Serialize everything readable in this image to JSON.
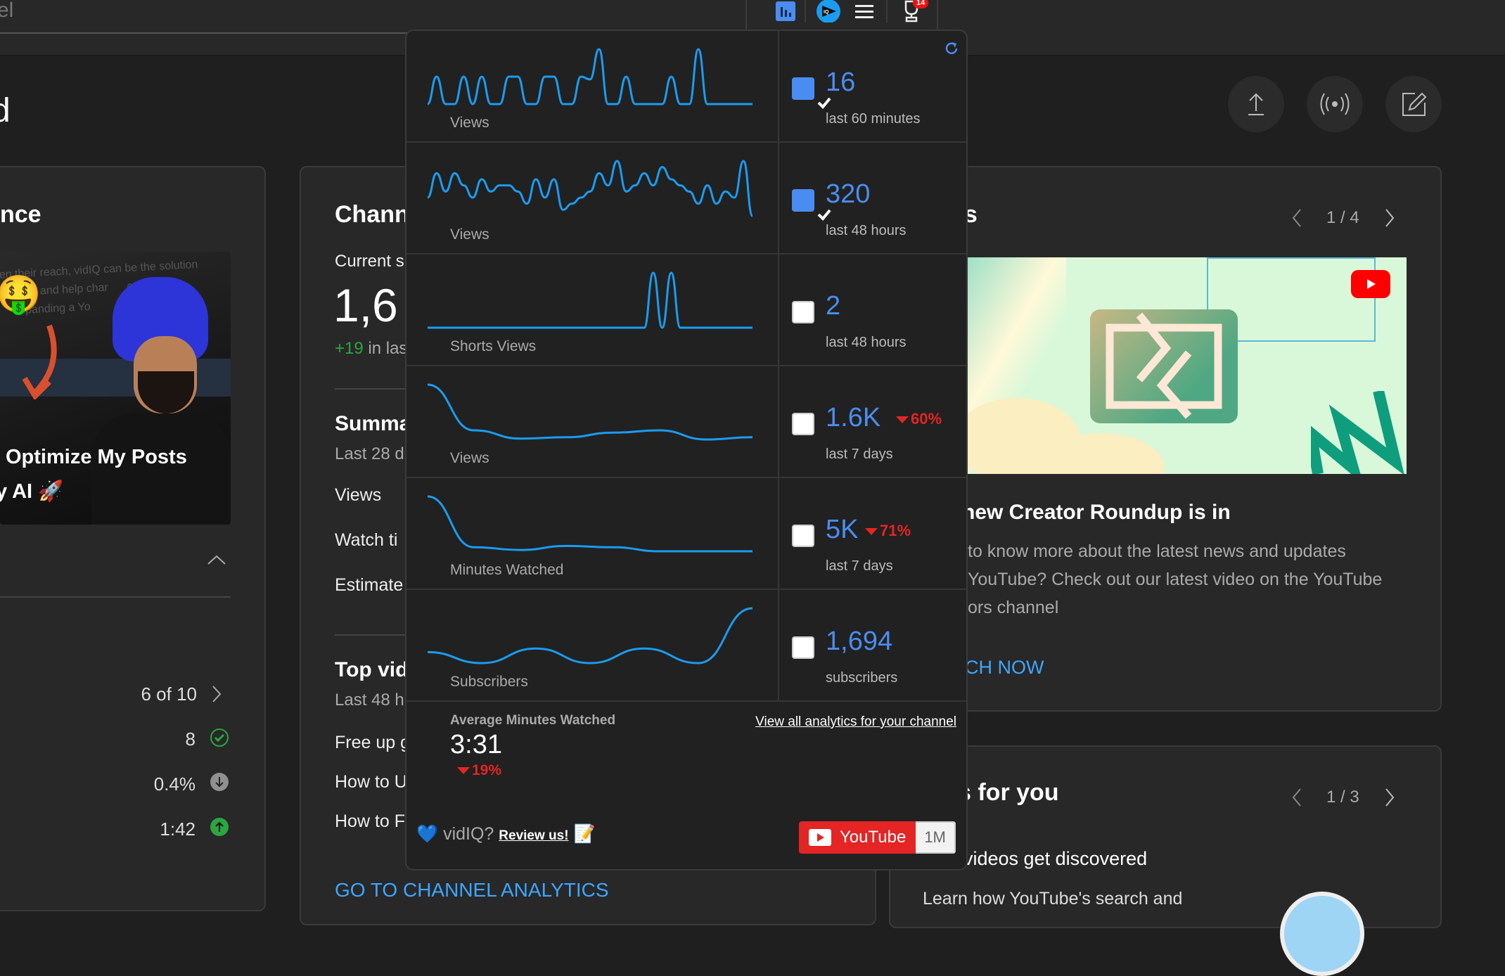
{
  "topbar": {
    "search_value": "el",
    "extension_badge": "14",
    "icons": [
      "analytics-icon",
      "vidiq-icon",
      "menu-icon",
      "achievements-icon"
    ]
  },
  "page": {
    "title": "d"
  },
  "header_actions": [
    "upload-icon",
    "live-icon",
    "create-post-icon"
  ],
  "perf_card": {
    "title": "nce",
    "thumbnail_caption_line1": "Optimize My Posts",
    "thumbnail_caption_line2": "y AI 🚀",
    "ranking": "6 of 10",
    "stats": [
      {
        "value": "8",
        "icon": "check-circle-icon"
      },
      {
        "value": "0.4%",
        "icon": "arrow-down-circle-icon"
      },
      {
        "value": "1:42",
        "icon": "arrow-up-circle-icon"
      }
    ]
  },
  "channel_card": {
    "title": "Chann",
    "current_label": "Current s",
    "subs_big": "1,6",
    "delta_value": "+19",
    "delta_text": " in las",
    "summary_title": "Summa",
    "summary_sub": "Last 28 d",
    "summary_rows": [
      "Views",
      "Watch ti",
      "Estimate"
    ],
    "top_title": "Top vid",
    "top_sub": "Last 48 h",
    "top_rows": [
      "Free up g",
      "How to U",
      "How to F"
    ],
    "cta": "GO TO CHANNEL ANALYTICS"
  },
  "news_card": {
    "title": "vs",
    "pager": "1 / 4",
    "headline": "new Creator Roundup is in",
    "body_lines": [
      "to know more about the latest news and updates",
      "YouTube? Check out our latest video on the YouTube",
      "ors channel"
    ],
    "cta": "CH NOW"
  },
  "ideas_card": {
    "title": "s for you",
    "pager": "1 / 3",
    "headline": "videos get discovered",
    "body": "Learn how YouTube's search and"
  },
  "popup": {
    "rows": [
      {
        "label": "Views",
        "value": "16",
        "sub": "last 60 minutes",
        "checked": true,
        "change": ""
      },
      {
        "label": "Views",
        "value": "320",
        "sub": "last 48 hours",
        "checked": true,
        "change": ""
      },
      {
        "label": "Shorts Views",
        "value": "2",
        "sub": "last 48 hours",
        "checked": false,
        "change": ""
      },
      {
        "label": "Views",
        "value": "1.6K",
        "sub": "last 7 days",
        "checked": false,
        "change": "60%"
      },
      {
        "label": "Minutes Watched",
        "value": "5K",
        "sub": "last 7 days",
        "checked": false,
        "change": "71%"
      },
      {
        "label": "Subscribers",
        "value": "1,694",
        "sub": "subscribers",
        "checked": false,
        "change": ""
      }
    ],
    "avg_label": "Average Minutes Watched",
    "avg_value": "3:31",
    "avg_change": "19%",
    "view_all_link": "View all analytics for your channel",
    "review_prefix": "💙 vidIQ? ",
    "review_link": "Review us!",
    "review_suffix": " 📝",
    "youtube_label": "YouTube",
    "youtube_count": "1M"
  },
  "chart_data": [
    {
      "type": "line",
      "title": "Views (last 60 minutes)",
      "values": [
        0,
        1,
        0,
        0,
        1,
        0,
        1,
        0,
        0,
        1,
        1,
        0,
        0,
        1,
        1,
        0,
        0,
        1,
        0.9,
        2,
        0,
        0,
        1,
        0,
        0,
        0,
        0,
        1,
        0,
        0,
        2,
        0,
        0,
        0,
        0,
        0,
        0
      ]
    },
    {
      "type": "line",
      "title": "Views (last 48 hours)",
      "values": [
        5,
        9,
        6,
        9,
        7,
        5,
        8,
        6,
        7,
        7,
        6,
        4,
        8,
        5,
        8,
        3,
        4,
        5,
        6,
        9,
        7,
        11,
        6,
        7,
        9,
        7,
        10,
        8,
        7,
        6,
        4,
        7,
        4,
        6,
        5,
        11,
        2
      ]
    },
    {
      "type": "line",
      "title": "Shorts Views (last 48 hours)",
      "values": [
        0,
        0,
        0,
        0,
        0,
        0,
        0,
        0,
        0,
        0,
        0,
        0,
        0,
        0,
        0,
        0,
        0,
        0,
        0,
        0,
        0,
        0,
        0,
        0,
        0,
        1,
        0,
        1,
        0,
        0,
        0,
        0,
        0,
        0,
        0,
        0,
        0
      ]
    },
    {
      "type": "line",
      "title": "Views (last 7 days)",
      "values": [
        330,
        230,
        212,
        215,
        225,
        230,
        210,
        215
      ]
    },
    {
      "type": "line",
      "title": "Minutes Watched (last 7 days)",
      "values": [
        1100,
        720,
        700,
        730,
        720,
        690,
        690,
        690
      ]
    },
    {
      "type": "line",
      "title": "Subscribers",
      "values": [
        1682,
        1679,
        1683,
        1679,
        1683,
        1679,
        1694
      ]
    }
  ]
}
